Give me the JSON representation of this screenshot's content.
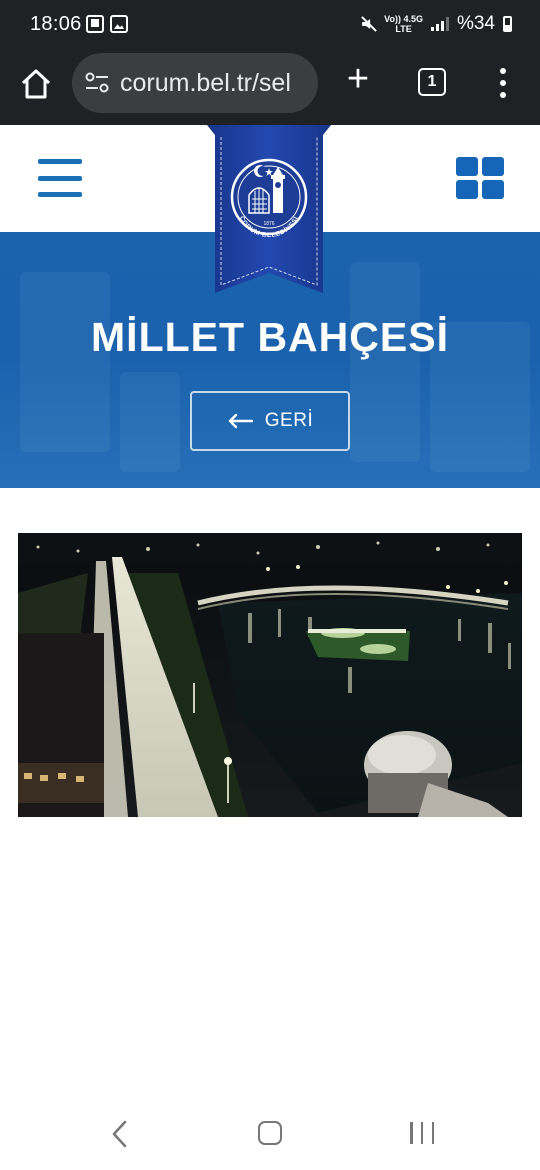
{
  "status_bar": {
    "time": "18:06",
    "network_top": "Vo)) 4.5G",
    "network_bottom": "LTE",
    "battery": "%34",
    "icons": [
      "gallery-icon",
      "photo-icon",
      "mute-icon",
      "signal-icon",
      "battery-icon"
    ]
  },
  "browser": {
    "url": "corum.bel.tr/sel",
    "tab_count": "1",
    "icons": [
      "home-icon",
      "site-settings-icon",
      "new-tab-icon",
      "tab-switcher-icon",
      "more-icon"
    ]
  },
  "site": {
    "title": "MİLLET BAHÇESİ",
    "back_label": "GERİ",
    "logo_text": "ÇORUM BELEDİYESİ",
    "logo_year": "1876",
    "colors": {
      "primary_blue": "#1b63ad",
      "ribbon_blue": "#1c3f9a",
      "ribbon_dark": "#142f7a"
    }
  },
  "camera": {
    "description_icon": "live-camera-image"
  },
  "nav": {
    "icons": [
      "nav-back-icon",
      "nav-home-icon",
      "nav-recents-icon"
    ]
  }
}
